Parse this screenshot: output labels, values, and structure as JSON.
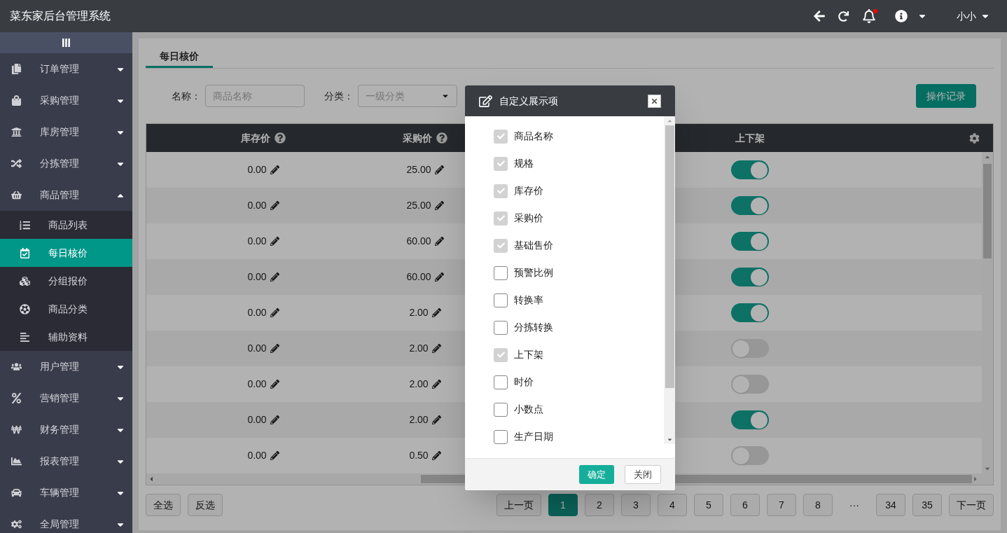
{
  "app_title": "菜东家后台管理系统",
  "top_bar": {
    "user": "小小",
    "has_notification": true
  },
  "sidebar": {
    "items": [
      {
        "label": "订单管理",
        "expanded": false
      },
      {
        "label": "采购管理",
        "expanded": false
      },
      {
        "label": "库房管理",
        "expanded": false
      },
      {
        "label": "分拣管理",
        "expanded": false
      },
      {
        "label": "商品管理",
        "expanded": true,
        "children": [
          {
            "label": "商品列表",
            "selected": false
          },
          {
            "label": "每日核价",
            "selected": true
          },
          {
            "label": "分组报价",
            "selected": false
          },
          {
            "label": "商品分类",
            "selected": false
          },
          {
            "label": "辅助资料",
            "selected": false
          }
        ]
      },
      {
        "label": "用户管理",
        "expanded": false
      },
      {
        "label": "营销管理",
        "expanded": false
      },
      {
        "label": "财务管理",
        "expanded": false
      },
      {
        "label": "报表管理",
        "expanded": false
      },
      {
        "label": "车辆管理",
        "expanded": false
      },
      {
        "label": "全局管理",
        "expanded": false
      }
    ]
  },
  "tabs": [
    {
      "label": "每日核价",
      "selected": true
    }
  ],
  "filters": {
    "name_label": "名称：",
    "name": {
      "placeholder": "商品名称"
    },
    "category_label": "分类：",
    "category": {
      "placeholder": "一级分类"
    }
  },
  "log_button": "操作记录",
  "table": {
    "columns": [
      {
        "label": "库存价",
        "help": true
      },
      {
        "label": "采购价",
        "help": true
      },
      {
        "label": "上下架",
        "help": false
      }
    ],
    "rows": [
      {
        "stock_price": "0.00",
        "purchase_price": "25.00",
        "on_shelf": true
      },
      {
        "stock_price": "0.00",
        "purchase_price": "25.00",
        "on_shelf": true
      },
      {
        "stock_price": "0.00",
        "purchase_price": "60.00",
        "on_shelf": true
      },
      {
        "stock_price": "0.00",
        "purchase_price": "60.00",
        "on_shelf": true
      },
      {
        "stock_price": "0.00",
        "purchase_price": "2.00",
        "on_shelf": true
      },
      {
        "stock_price": "0.00",
        "purchase_price": "2.00",
        "on_shelf": false
      },
      {
        "stock_price": "0.00",
        "purchase_price": "2.00",
        "on_shelf": false
      },
      {
        "stock_price": "0.00",
        "purchase_price": "2.00",
        "on_shelf": true
      },
      {
        "stock_price": "0.00",
        "purchase_price": "0.50",
        "on_shelf": false
      }
    ]
  },
  "selection_buttons": [
    "全选",
    "反选"
  ],
  "pagination": {
    "prev": "上一页",
    "pages": [
      {
        "label": "1",
        "selected": true
      },
      {
        "label": "2",
        "selected": false
      },
      {
        "label": "3",
        "selected": false
      },
      {
        "label": "4",
        "selected": false
      },
      {
        "label": "5",
        "selected": false
      },
      {
        "label": "6",
        "selected": false
      },
      {
        "label": "7",
        "selected": false
      },
      {
        "label": "8",
        "selected": false
      }
    ],
    "ellipsis": "···",
    "last_pages": [
      {
        "label": "34",
        "selected": false
      },
      {
        "label": "35",
        "selected": false
      }
    ],
    "next": "下一页"
  },
  "modal": {
    "title": "自定义展示项",
    "items": [
      {
        "label": "商品名称",
        "checked": true
      },
      {
        "label": "规格",
        "checked": true
      },
      {
        "label": "库存价",
        "checked": true
      },
      {
        "label": "采购价",
        "checked": true
      },
      {
        "label": "基础售价",
        "checked": true
      },
      {
        "label": "预警比例",
        "checked": false
      },
      {
        "label": "转换率",
        "checked": false
      },
      {
        "label": "分拣转换",
        "checked": false
      },
      {
        "label": "上下架",
        "checked": true
      },
      {
        "label": "时价",
        "checked": false
      },
      {
        "label": "小数点",
        "checked": false
      },
      {
        "label": "生产日期",
        "checked": false
      }
    ],
    "confirm": "确定",
    "close": "关闭"
  }
}
